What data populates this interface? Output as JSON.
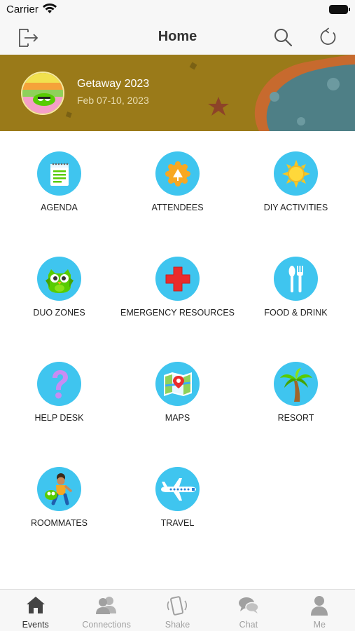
{
  "status_bar": {
    "carrier": "Carrier"
  },
  "nav": {
    "title": "Home"
  },
  "event": {
    "title": "Getaway 2023",
    "dates": "Feb 07-10, 2023"
  },
  "tiles": [
    {
      "label": "AGENDA",
      "icon": "agenda-icon"
    },
    {
      "label": "ATTENDEES",
      "icon": "attendees-icon"
    },
    {
      "label": "DIY ACTIVITIES",
      "icon": "sun-icon"
    },
    {
      "label": "DUO ZONES",
      "icon": "owl-icon"
    },
    {
      "label": "EMERGENCY RESOURCES",
      "icon": "red-cross-icon"
    },
    {
      "label": "FOOD & DRINK",
      "icon": "fork-knife-icon"
    },
    {
      "label": "HELP DESK",
      "icon": "question-mark-icon"
    },
    {
      "label": "MAPS",
      "icon": "map-icon"
    },
    {
      "label": "RESORT",
      "icon": "palm-tree-icon"
    },
    {
      "label": "ROOMMATES",
      "icon": "roommates-icon"
    },
    {
      "label": "TRAVEL",
      "icon": "airplane-icon"
    }
  ],
  "tabs": [
    {
      "label": "Events",
      "icon": "house-icon",
      "active": true
    },
    {
      "label": "Connections",
      "icon": "people-icon",
      "active": false
    },
    {
      "label": "Shake",
      "icon": "shake-phone-icon",
      "active": false
    },
    {
      "label": "Chat",
      "icon": "chat-bubbles-icon",
      "active": false
    },
    {
      "label": "Me",
      "icon": "person-icon",
      "active": false
    }
  ],
  "colors": {
    "tile_circle": "#3fc5ef",
    "banner": "#9a7a19",
    "active_tab": "#333333",
    "inactive_tab": "#a0a0a0"
  }
}
